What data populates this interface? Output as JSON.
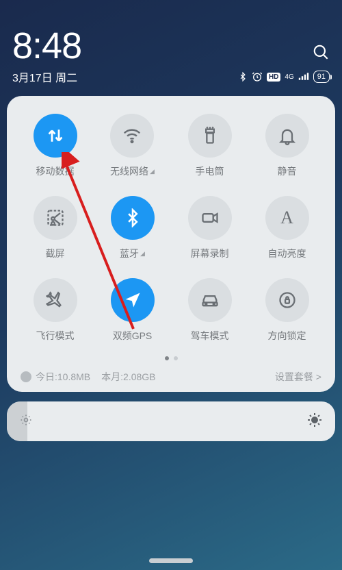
{
  "clock": {
    "time": "8:48",
    "date": "3月17日 周二"
  },
  "status": {
    "signal_label": "4G",
    "battery": "91"
  },
  "toggles": [
    {
      "k": "mobile-data",
      "label": "移动数据",
      "state": "on",
      "icon": "data-arrows",
      "chev": false
    },
    {
      "k": "wifi",
      "label": "无线网络",
      "state": "off",
      "icon": "wifi",
      "chev": true
    },
    {
      "k": "flashlight",
      "label": "手电筒",
      "state": "off",
      "icon": "flashlight",
      "chev": false
    },
    {
      "k": "mute",
      "label": "静音",
      "state": "off",
      "icon": "bell",
      "chev": false
    },
    {
      "k": "screenshot",
      "label": "截屏",
      "state": "off",
      "icon": "scissors",
      "chev": false
    },
    {
      "k": "bluetooth",
      "label": "蓝牙",
      "state": "on",
      "icon": "bluetooth",
      "chev": true
    },
    {
      "k": "screen-record",
      "label": "屏幕录制",
      "state": "off",
      "icon": "video",
      "chev": false
    },
    {
      "k": "auto-bright",
      "label": "自动亮度",
      "state": "off",
      "icon": "letter-a",
      "chev": false
    },
    {
      "k": "airplane",
      "label": "飞行模式",
      "state": "off",
      "icon": "plane",
      "chev": false
    },
    {
      "k": "gps",
      "label": "双频GPS",
      "state": "on",
      "icon": "nav",
      "chev": false
    },
    {
      "k": "drive-mode",
      "label": "驾车模式",
      "state": "off",
      "icon": "car",
      "chev": false
    },
    {
      "k": "rotation-lock",
      "label": "方向锁定",
      "state": "off",
      "icon": "lock-rotate",
      "chev": false
    }
  ],
  "pager": {
    "active": 0,
    "count": 2
  },
  "usage": {
    "today_label": "今日:",
    "today": "10.8MB",
    "month_label": "本月:",
    "month": "2.08GB",
    "plan_link": "设置套餐 >"
  },
  "annotation_target": "mobile-data"
}
